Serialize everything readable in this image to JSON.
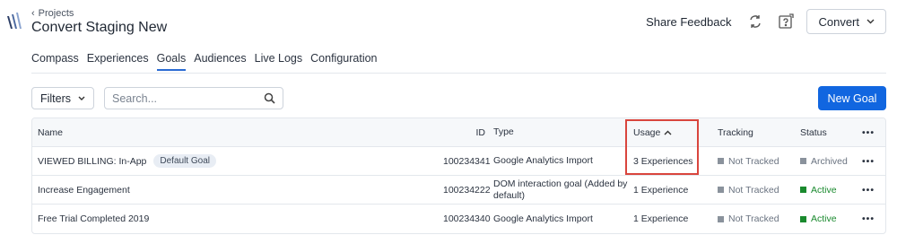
{
  "breadcrumb": {
    "label": "Projects"
  },
  "project": {
    "title": "Convert Staging New"
  },
  "header": {
    "share_feedback": "Share Feedback",
    "convert_label": "Convert"
  },
  "tabs": [
    {
      "label": "Compass"
    },
    {
      "label": "Experiences"
    },
    {
      "label": "Goals",
      "active": true
    },
    {
      "label": "Audiences"
    },
    {
      "label": "Live Logs"
    },
    {
      "label": "Configuration"
    }
  ],
  "toolbar": {
    "filters_label": "Filters",
    "search_placeholder": "Search...",
    "new_goal_label": "New Goal"
  },
  "table": {
    "headers": {
      "name": "Name",
      "id": "ID",
      "type": "Type",
      "usage": "Usage",
      "tracking": "Tracking",
      "status": "Status",
      "more": "•••"
    },
    "rows": [
      {
        "name": "VIEWED BILLING: In-App",
        "badge": "Default Goal",
        "id": "100234341",
        "type": "Google Analytics Import",
        "usage": "3 Experiences",
        "tracking": "Not Tracked",
        "status": "Archived",
        "more": "•••"
      },
      {
        "name": "Increase Engagement",
        "id": "100234222",
        "type": "DOM interaction goal (Added by default)",
        "usage": "1 Experience",
        "tracking": "Not Tracked",
        "status": "Active",
        "more": "•••"
      },
      {
        "name": "Free Trial Completed 2019",
        "id": "100234340",
        "type": "Google Analytics Import",
        "usage": "1 Experience",
        "tracking": "Not Tracked",
        "status": "Active",
        "more": "•••"
      }
    ]
  },
  "colors": {
    "accent": "#1166e0",
    "active_status": "#1a8a2e",
    "archived_status": "#8a929c",
    "highlight": "#d9453d"
  }
}
